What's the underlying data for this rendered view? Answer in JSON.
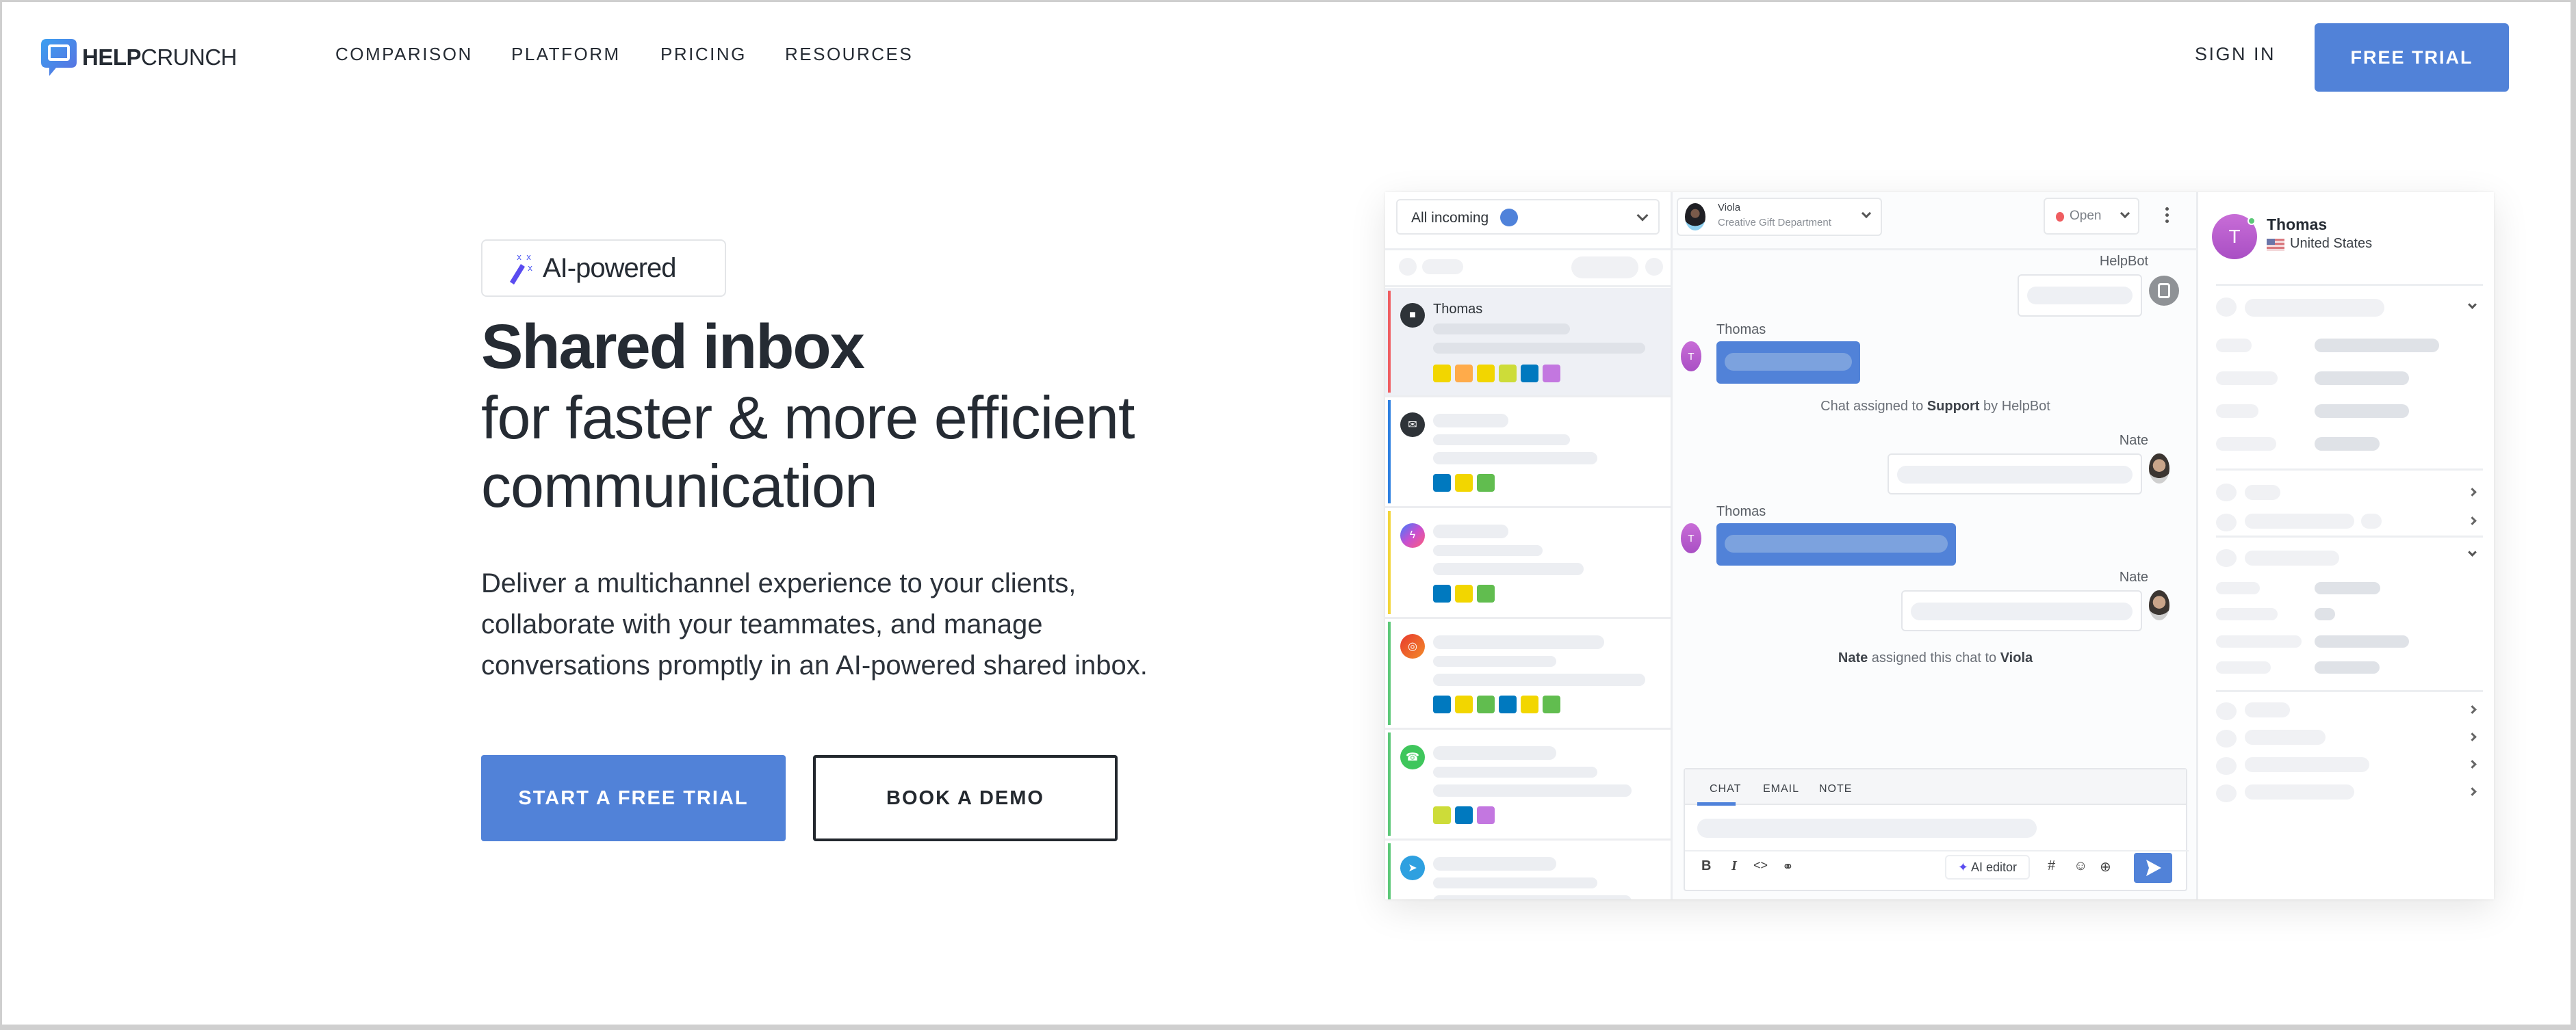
{
  "nav": {
    "logo": {
      "bold": "HELP",
      "light": "CRUNCH"
    },
    "items": [
      {
        "label": "COMPARISON"
      },
      {
        "label": "PLATFORM"
      },
      {
        "label": "PRICING"
      },
      {
        "label": "RESOURCES"
      }
    ],
    "sign_in": "SIGN IN",
    "free_trial": "FREE TRIAL"
  },
  "hero": {
    "badge": "AI-powered",
    "title_bold": "Shared inbox",
    "title_line2": "for faster & more efficient",
    "title_line3": "communication",
    "paragraph_lines": [
      "Deliver a multichannel experience to your clients,",
      "collaborate with your teammates, and manage",
      "conversations promptly in an AI-powered shared inbox."
    ],
    "cta_primary": "START A FREE TRIAL",
    "cta_secondary": "BOOK A DEMO"
  },
  "mockup": {
    "inbox_filter": "All incoming",
    "conversations": [
      {
        "name": "Thomas",
        "channel": "chat-icon",
        "accent": "#ef5d60",
        "tags": [
          "#f2d600",
          "#ffab4a",
          "#f2d600",
          "#cddc39",
          "#0079bf",
          "#c377e0"
        ]
      },
      {
        "name": "",
        "channel": "email-icon",
        "accent": "#2d7fe0",
        "tags": [
          "#0079bf",
          "#f2d600",
          "#61bd4f"
        ]
      },
      {
        "name": "",
        "channel": "messenger-icon",
        "accent": "#f2d43a",
        "tags": [
          "#0079bf",
          "#f2d600",
          "#61bd4f"
        ]
      },
      {
        "name": "",
        "channel": "instagram-icon",
        "accent": "#5cc878",
        "tags": [
          "#0079bf",
          "#f2d600",
          "#61bd4f",
          "#0079bf",
          "#f2d600",
          "#61bd4f"
        ]
      },
      {
        "name": "",
        "channel": "whatsapp-icon",
        "accent": "#5cc878",
        "tags": [
          "#cddc39",
          "#0079bf",
          "#c377e0"
        ]
      },
      {
        "name": "",
        "channel": "telegram-icon",
        "accent": "#5cc878",
        "tags": []
      }
    ],
    "assignee": {
      "name": "Viola",
      "department": "Creative Gift Department"
    },
    "status": "Open",
    "messages": [
      {
        "author": "HelpBot"
      },
      {
        "author": "Thomas",
        "initial": "T"
      },
      {
        "system": [
          "Chat assigned to ",
          "Support",
          " by HelpBot"
        ]
      },
      {
        "author": "Nate"
      },
      {
        "author": "Thomas",
        "initial": "T"
      },
      {
        "author": "Nate"
      },
      {
        "system": [
          "Nate",
          " assigned this chat to ",
          "Viola"
        ]
      }
    ],
    "composer": {
      "tabs": [
        "CHAT",
        "EMAIL",
        "NOTE"
      ],
      "active_tab": "CHAT",
      "ai_editor": "AI editor"
    },
    "contact": {
      "name": "Thomas",
      "initial": "T",
      "country": "United States"
    }
  },
  "colors": {
    "brand": "#5182d8",
    "text": "#252b33"
  }
}
